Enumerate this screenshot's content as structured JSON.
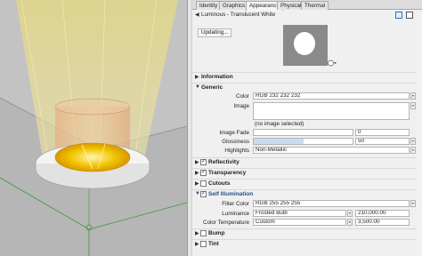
{
  "tabs": [
    "Identity",
    "Graphics",
    "Appearance",
    "Physical",
    "Thermal"
  ],
  "active_tab": "Appearance",
  "material": {
    "name": "Luminous - Translucent White"
  },
  "updating_label": "Updating...",
  "sections": {
    "information": "Information",
    "generic": "Generic",
    "reflectivity": "Reflectivity",
    "transparency": "Transparency",
    "cutouts": "Cutouts",
    "self_illumination": "Self Illumination",
    "bump": "Bump",
    "tint": "Tint"
  },
  "generic": {
    "color_label": "Color",
    "color_value": "RGB 232 232 232",
    "image_label": "Image",
    "image_note": "(no image selected)",
    "image_fade_label": "Image Fade",
    "image_fade_value": "0",
    "glossiness_label": "Glossiness",
    "glossiness_value": "50",
    "glossiness_fraction": 0.5,
    "highlights_label": "Highlights",
    "highlights_value": "Non-Metallic"
  },
  "self_illumination": {
    "filter_color_label": "Filter Color",
    "filter_color_value": "RGB 255 255 255",
    "luminance_label": "Luminance",
    "luminance_value": "Frosted Bulb",
    "luminance_number": "210,000.00",
    "color_temp_label": "Color Temperature",
    "color_temp_value": "Custom",
    "color_temp_number": "3,500.00"
  },
  "checks": {
    "reflectivity": true,
    "transparency": true,
    "cutouts": false,
    "self_illumination": true,
    "bump": false,
    "tint": false
  },
  "colors": {
    "accent": "#1a4f8c",
    "glossiness_bar": "#c7dcf0",
    "viewport_bg": "#bdbdbd",
    "ring_inner": "#f0a000"
  }
}
